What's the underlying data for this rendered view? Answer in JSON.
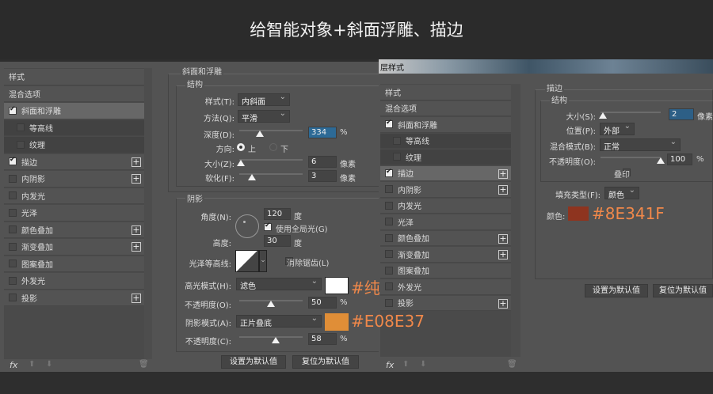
{
  "banner": {
    "title": "给智能对象+斜面浮雕、描边"
  },
  "style_list_items": [
    {
      "label": "样式",
      "check": null,
      "plus": false
    },
    {
      "label": "混合选项",
      "check": null,
      "plus": false
    },
    {
      "label": "斜面和浮雕",
      "check": true,
      "plus": false
    },
    {
      "label": "等高线",
      "check": false,
      "plus": false,
      "sub": true
    },
    {
      "label": "纹理",
      "check": false,
      "plus": false,
      "sub": true
    },
    {
      "label": "描边",
      "check": true,
      "plus": true
    },
    {
      "label": "内阴影",
      "check": false,
      "plus": true
    },
    {
      "label": "内发光",
      "check": false,
      "plus": false
    },
    {
      "label": "光泽",
      "check": false,
      "plus": false
    },
    {
      "label": "颜色叠加",
      "check": false,
      "plus": true
    },
    {
      "label": "渐变叠加",
      "check": false,
      "plus": true
    },
    {
      "label": "图案叠加",
      "check": false,
      "plus": false
    },
    {
      "label": "外发光",
      "check": false,
      "plus": false
    },
    {
      "label": "投影",
      "check": false,
      "plus": true
    }
  ],
  "footer_icons": {
    "fx": "fx"
  },
  "bevel": {
    "title": "斜面和浮雕",
    "structure": "结构",
    "style_label": "样式(T):",
    "style_value": "内斜面",
    "technique_label": "方法(Q):",
    "technique_value": "平滑",
    "depth_label": "深度(D):",
    "depth_value": "334",
    "depth_unit": "%",
    "depth_fraction": 0.33,
    "direction_label": "方向:",
    "dir_up": "上",
    "dir_down": "下",
    "size_label": "大小(Z):",
    "size_value": "6",
    "size_unit": "像素",
    "size_fraction": 0.02,
    "soften_label": "软化(F):",
    "soften_value": "3",
    "soften_unit": "像素",
    "soften_fraction": 0.2,
    "shading": "阴影",
    "angle_label": "角度(N):",
    "angle_value": "120",
    "angle_unit": "度",
    "global_light": "使用全局光(G)",
    "altitude_label": "高度:",
    "altitude_value": "30",
    "altitude_unit": "度",
    "gloss_label": "光泽等高线:",
    "antialias": "消除锯齿(L)",
    "highlight_label": "高光模式(H):",
    "highlight_value": "滤色",
    "highlight_color": "#ffffff",
    "hl_opacity_label": "不透明度(O):",
    "hl_opacity_value": "50",
    "hl_opacity_unit": "%",
    "shadow_label": "阴影模式(A):",
    "shadow_value": "正片叠底",
    "shadow_color": "#E08E37",
    "sh_opacity_label": "不透明度(C):",
    "sh_opacity_value": "58",
    "sh_opacity_unit": "%",
    "btn_default": "设置为默认值",
    "btn_reset": "复位为默认值"
  },
  "dialog2": {
    "title": "层样式"
  },
  "stroke": {
    "title": "描边",
    "structure": "结构",
    "size_label": "大小(S):",
    "size_value": "2",
    "size_unit": "像素",
    "position_label": "位置(P):",
    "position_value": "外部",
    "blend_label": "混合模式(B):",
    "blend_value": "正常",
    "opacity_label": "不透明度(O):",
    "opacity_value": "100",
    "opacity_unit": "%",
    "overprint": "叠印",
    "fill_label": "填充类型(F):",
    "fill_value": "颜色",
    "color_label": "颜色:",
    "color": "#8E341F",
    "btn_default": "设置为默认值",
    "btn_reset": "复位为默认值"
  },
  "annotations": {
    "white": "#纯白",
    "orange": "#E08E37",
    "red": "#8E341F"
  }
}
